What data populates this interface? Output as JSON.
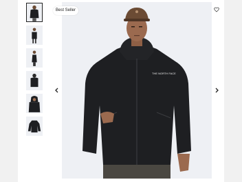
{
  "gallery": {
    "badge": "Best Seller",
    "prev_icon": "chevron-left-icon",
    "next_icon": "chevron-right-icon",
    "wishlist_icon": "heart-icon",
    "thumbnail_count": 6,
    "active_thumbnail": 1,
    "product_color": "#1e1f22",
    "background_color": "#eef0f4"
  }
}
